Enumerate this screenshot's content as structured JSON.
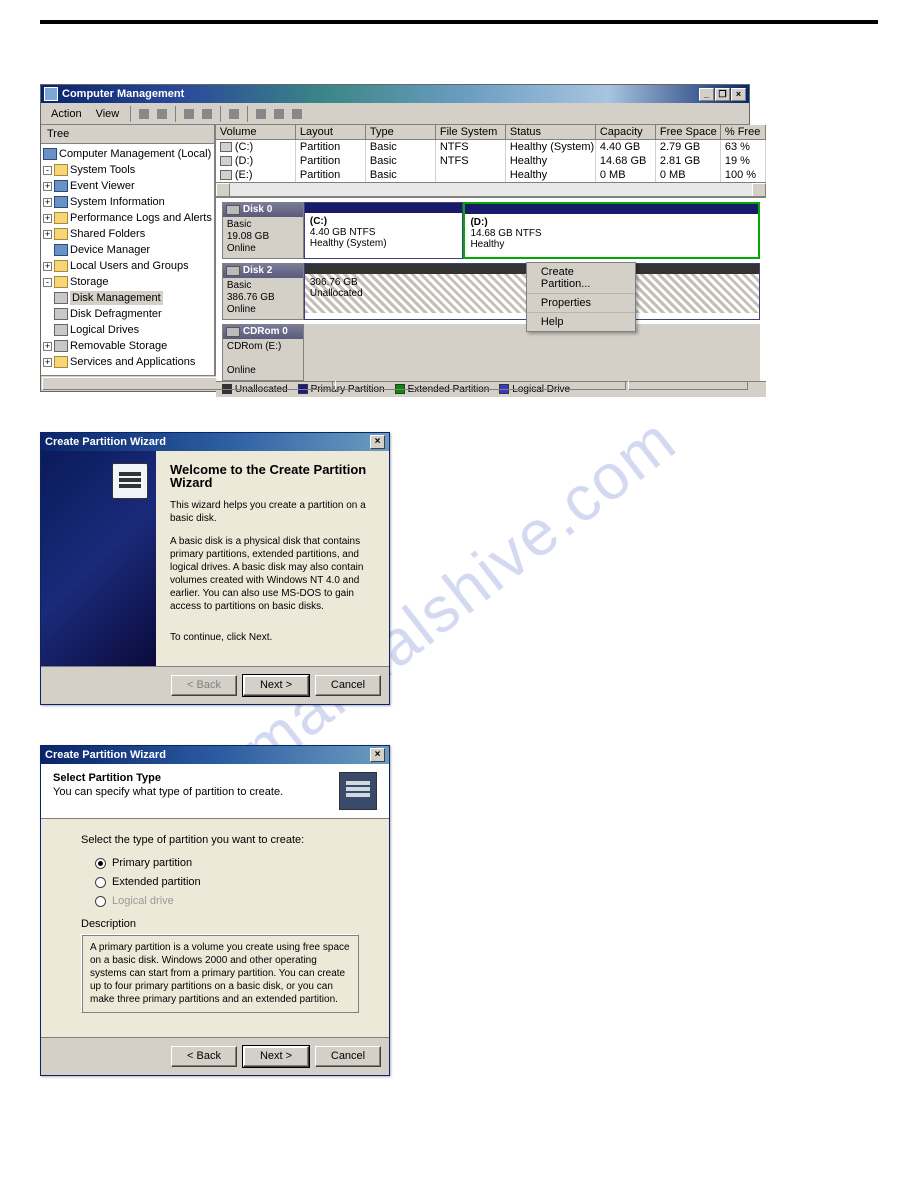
{
  "cmgmt": {
    "title": "Computer Management",
    "menu": {
      "action": "Action",
      "view": "View"
    },
    "tree_header": "Tree",
    "tree": {
      "root": "Computer Management (Local)",
      "systools": "System Tools",
      "evtviewer": "Event Viewer",
      "sysinfo": "System Information",
      "perflogs": "Performance Logs and Alerts",
      "shared": "Shared Folders",
      "devmgr": "Device Manager",
      "localusers": "Local Users and Groups",
      "storage": "Storage",
      "diskmgmt": "Disk Management",
      "defrag": "Disk Defragmenter",
      "logical": "Logical Drives",
      "removable": "Removable Storage",
      "svcs": "Services and Applications"
    },
    "cols": {
      "volume": "Volume",
      "layout": "Layout",
      "type": "Type",
      "fs": "File System",
      "status": "Status",
      "capacity": "Capacity",
      "free": "Free Space",
      "pct": "% Free"
    },
    "rows": [
      {
        "vol": "(C:)",
        "layout": "Partition",
        "type": "Basic",
        "fs": "NTFS",
        "status": "Healthy (System)",
        "cap": "4.40 GB",
        "free": "2.79 GB",
        "pct": "63 %"
      },
      {
        "vol": "(D:)",
        "layout": "Partition",
        "type": "Basic",
        "fs": "NTFS",
        "status": "Healthy",
        "cap": "14.68 GB",
        "free": "2.81 GB",
        "pct": "19 %"
      },
      {
        "vol": "(E:)",
        "layout": "Partition",
        "type": "Basic",
        "fs": "",
        "status": "Healthy",
        "cap": "0 MB",
        "free": "0 MB",
        "pct": "100 %"
      }
    ],
    "disks": {
      "d0": {
        "name": "Disk 0",
        "kind": "Basic",
        "size": "19.08 GB",
        "state": "Online",
        "p1": {
          "l1": "(C:)",
          "l2": "4.40 GB NTFS",
          "l3": "Healthy (System)"
        },
        "p2": {
          "l1": "(D:)",
          "l2": "14.68 GB NTFS",
          "l3": "Healthy"
        }
      },
      "d2": {
        "name": "Disk 2",
        "kind": "Basic",
        "size": "386.76 GB",
        "state": "Online",
        "p1": {
          "l1": "306.76 GB",
          "l2": "Unallocated"
        }
      },
      "cd": {
        "name": "CDRom 0",
        "sub": "CDRom (E:)",
        "state": "Online"
      }
    },
    "context": {
      "create": "Create Partition...",
      "props": "Properties",
      "help": "Help"
    },
    "legend": {
      "unalloc": "Unallocated",
      "primary": "Primary Partition",
      "extended": "Extended Partition",
      "logical": "Logical Drive"
    }
  },
  "wiz1": {
    "title": "Create Partition Wizard",
    "heading": "Welcome to the Create Partition Wizard",
    "p1": "This wizard helps you create a partition on a basic disk.",
    "p2": "A basic disk is a physical disk that contains primary partitions, extended partitions, and logical drives. A basic disk may also contain volumes created with Windows NT 4.0 and earlier. You can also use MS-DOS to gain access to partitions on basic disks.",
    "p3": "To continue, click Next.",
    "back": "< Back",
    "next": "Next >",
    "cancel": "Cancel"
  },
  "wiz2": {
    "title": "Create Partition Wizard",
    "head": "Select Partition Type",
    "sub": "You can specify what type of partition to create.",
    "prompt": "Select the type of partition you want to create:",
    "r1": "Primary partition",
    "r2": "Extended partition",
    "r3": "Logical drive",
    "desc_label": "Description",
    "desc": "A primary partition is a volume you create using free space on a basic disk. Windows 2000 and other operating systems can start from a primary partition. You can create up to four primary partitions on a basic disk, or you can make three primary partitions and an extended partition.",
    "back": "< Back",
    "next": "Next >",
    "cancel": "Cancel"
  },
  "watermark": "manualshive.com"
}
